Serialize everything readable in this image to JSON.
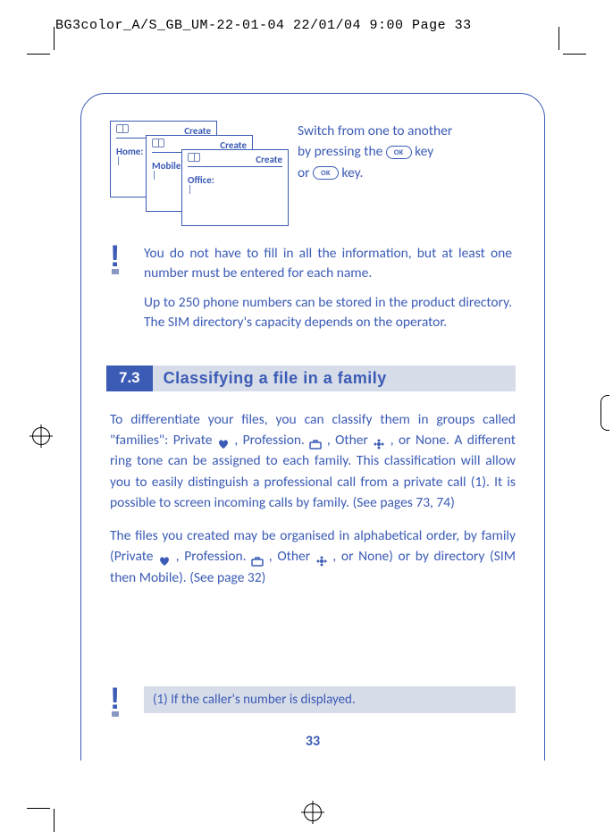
{
  "header": "BG3color_A/S_GB_UM-22-01-04  22/01/04  9:00  Page 33",
  "cards": {
    "create": "Create",
    "home": "Home:",
    "mobile": "Mobile:",
    "office": "Office:"
  },
  "switch": {
    "l1": "Switch from one to another",
    "l2a": "by pressing the ",
    "l2b": " key",
    "l3a": "or ",
    "l3b": " key."
  },
  "ok": "OK",
  "note": {
    "p1": "You do not have to fill in all the information, but at least one number must be entered for each name.",
    "p2": "Up to 250 phone numbers can be stored in the product directory. The SIM directory's capacity depends on the operator."
  },
  "section": {
    "num": "7.3",
    "title": "Classifying a file in a family"
  },
  "body": {
    "p1a": "To differentiate your files, you can classify them in groups called \"families\": Private ",
    "p1b": " , Profession. ",
    "p1c": " , Other ",
    "p1d": " , or None. A different ring tone can be assigned to each family. This classification will allow you to easily distinguish a professional call from a private call (1). It is possible to screen incoming calls by family. (See pages 73, 74)",
    "p2a": "The files you created may be organised in alphabetical order, by family (Private ",
    "p2b": " , Profession. ",
    "p2c": " , Other ",
    "p2d": " , or None) or by directory (SIM then Mobile). (See page 32)"
  },
  "footnote": "(1)  If the caller's number is displayed.",
  "pagenum": "33"
}
